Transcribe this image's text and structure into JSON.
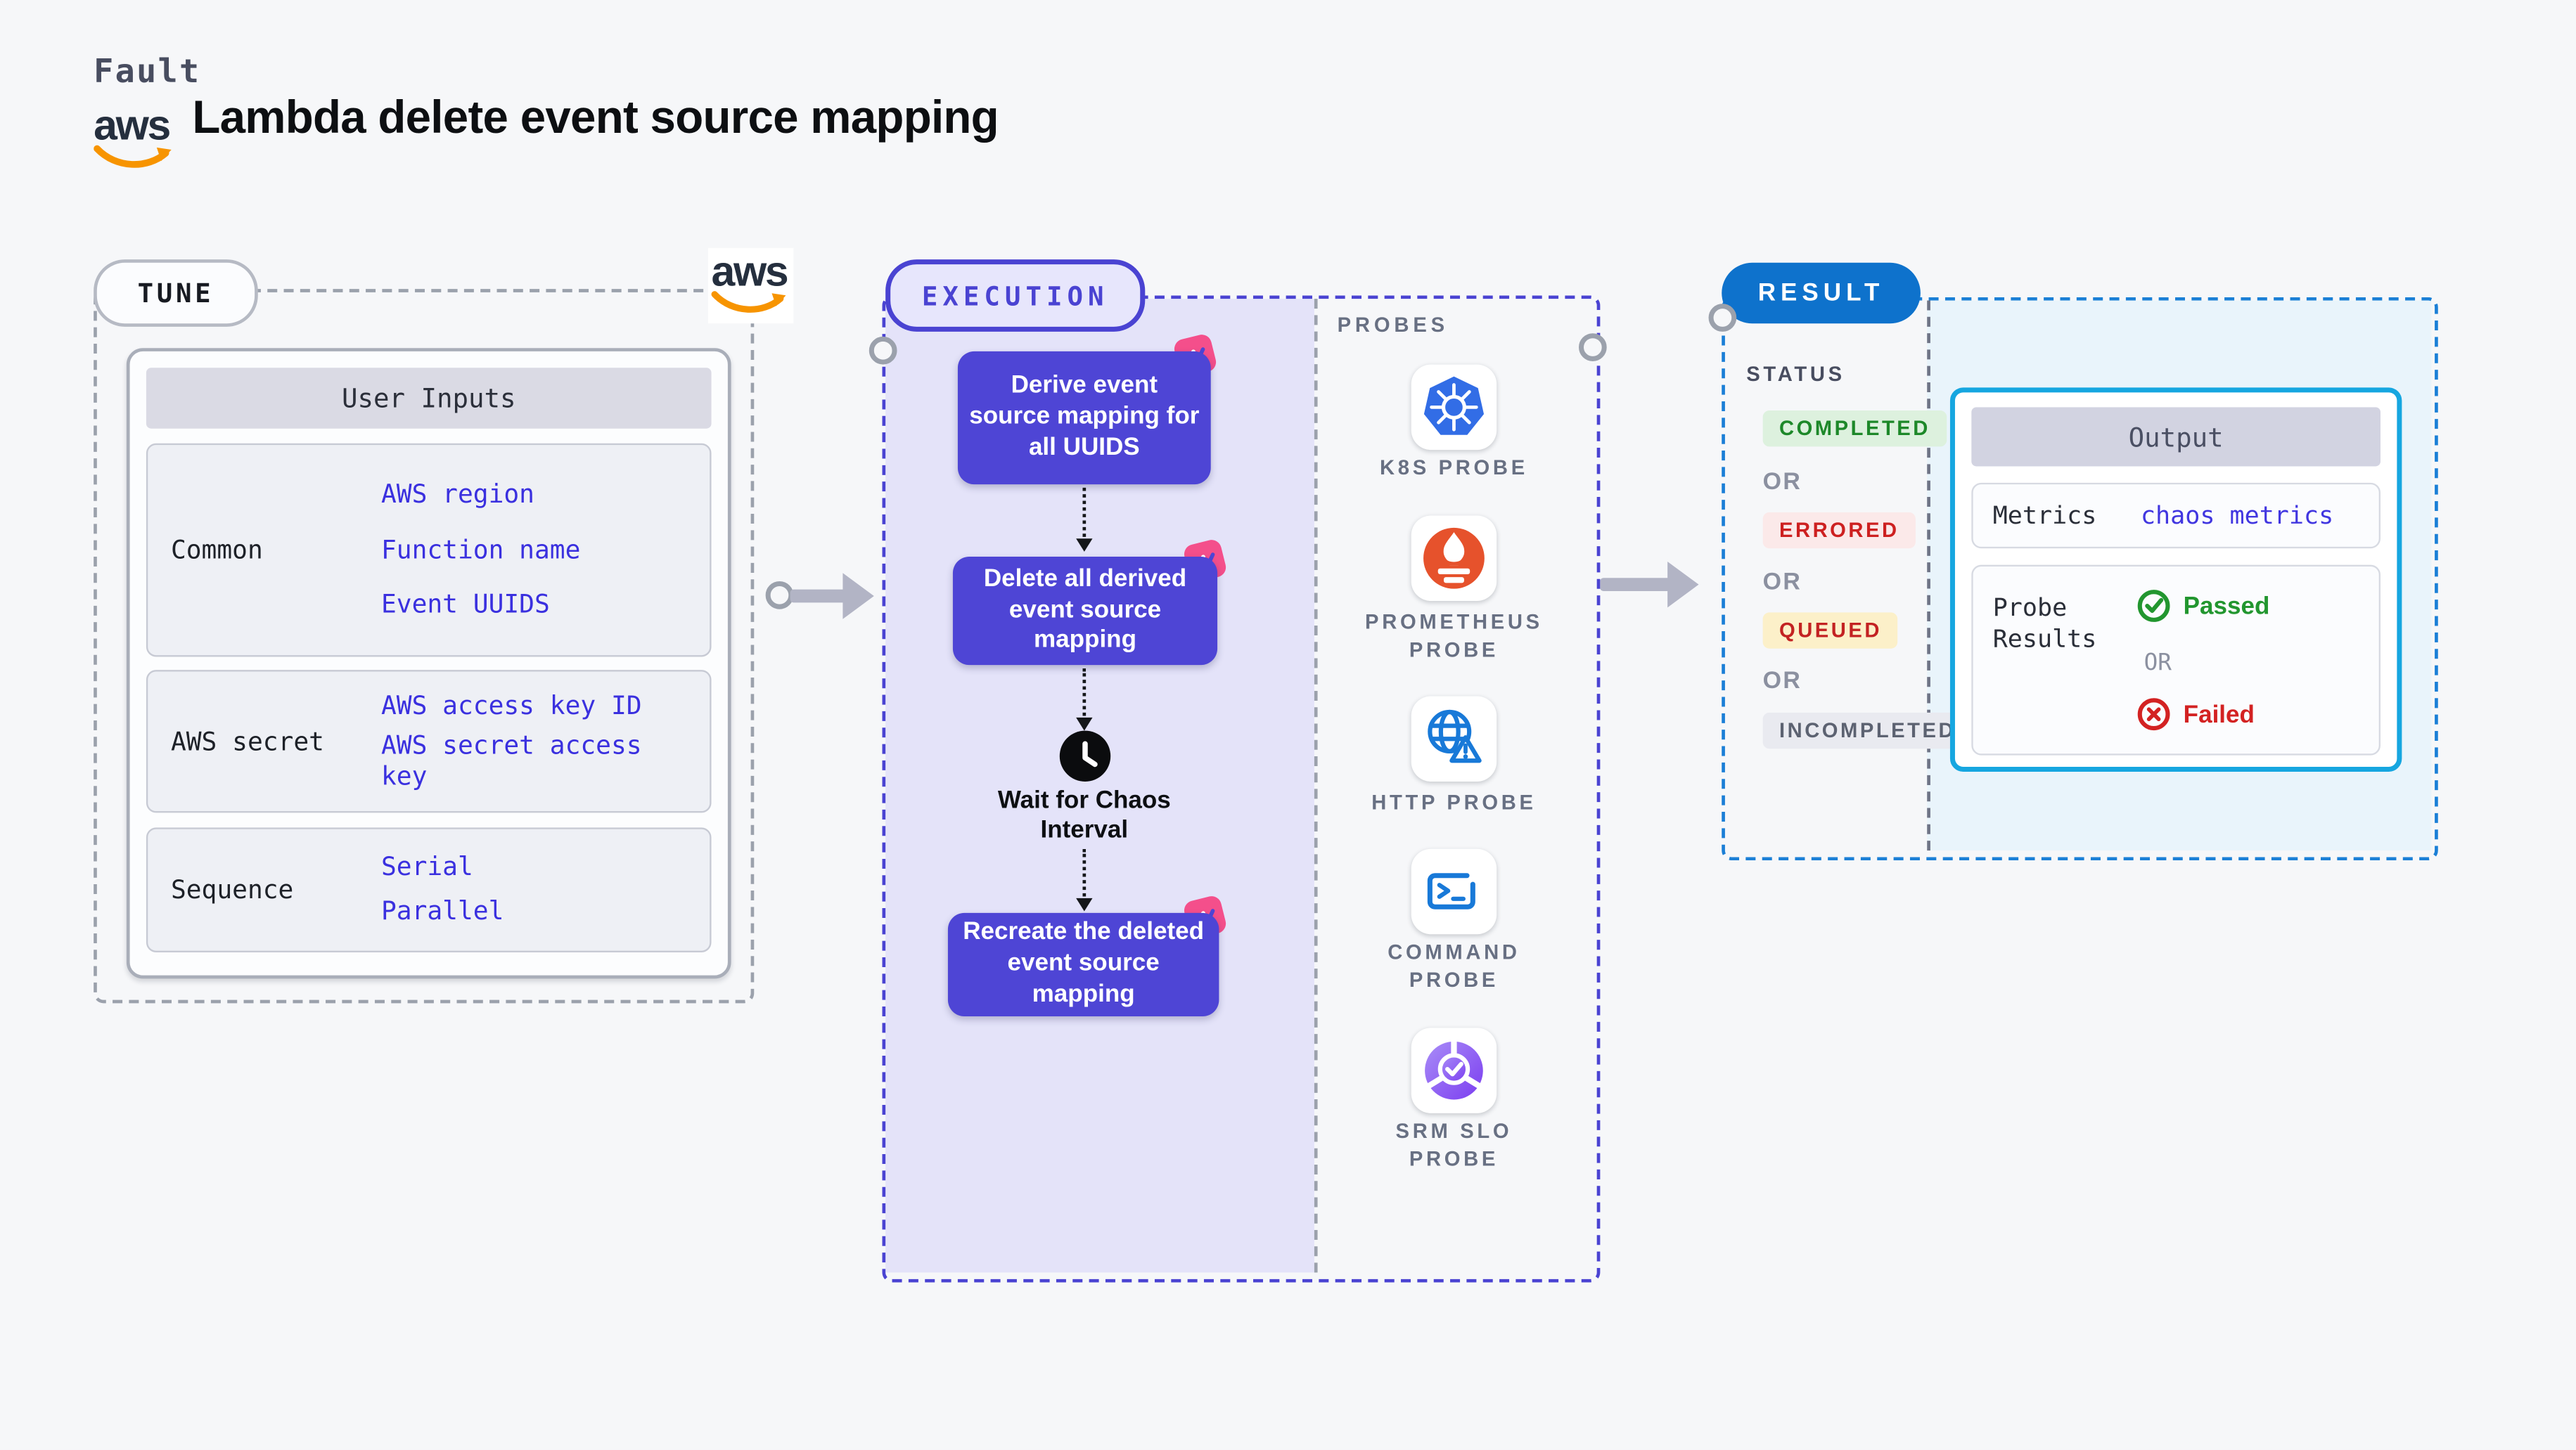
{
  "page": {
    "fault_label": "Fault",
    "title": "Lambda delete event source mapping",
    "background": "#f6f7f9"
  },
  "aws_logo": {
    "text": "aws",
    "text_color": "#252f3e",
    "smile_color": "#f79400"
  },
  "tune": {
    "pill_label": "TUNE",
    "table": {
      "header": "User Inputs",
      "rows": [
        {
          "label": "Common",
          "links": [
            "AWS region",
            "Function name",
            "Event UUIDS"
          ]
        },
        {
          "label": "AWS secret",
          "links": [
            "AWS access key ID",
            "AWS secret access key"
          ]
        },
        {
          "label": "Sequence",
          "links": [
            "Serial",
            "Parallel"
          ]
        }
      ]
    },
    "link_color": "#3a30df"
  },
  "execution": {
    "pill_label": "EXECUTION",
    "accent_color": "#4a43d2",
    "node_color": "#4e45d5",
    "badge_color": "#f44f8b",
    "nodes": [
      "Derive event source mapping for all UUIDS",
      "Delete all derived event source mapping",
      "Recreate the deleted event source mapping"
    ],
    "wait_label": "Wait for Chaos Interval"
  },
  "probes": {
    "label": "PROBES",
    "items": [
      {
        "name": "K8S PROBE",
        "icon": "kubernetes-icon",
        "color": "#326de6"
      },
      {
        "name": "PROMETHEUS PROBE",
        "icon": "prometheus-icon",
        "color": "#e6522c"
      },
      {
        "name": "HTTP PROBE",
        "icon": "http-globe-warning-icon",
        "color": "#1879d8"
      },
      {
        "name": "COMMAND PROBE",
        "icon": "terminal-icon",
        "color": "#1879d8"
      },
      {
        "name": "SRM SLO PROBE",
        "icon": "srm-slo-icon",
        "color": "#7b3df0"
      }
    ]
  },
  "result": {
    "pill_label": "RESULT",
    "pill_color": "#0e72cc",
    "status_label": "STATUS",
    "or_label": "OR",
    "statuses": [
      {
        "label": "COMPLETED",
        "fg": "#1d8829",
        "bg": "#ddf1de"
      },
      {
        "label": "ERRORED",
        "fg": "#cd2020",
        "bg": "#fbe9e9"
      },
      {
        "label": "QUEUED",
        "fg": "#c32222",
        "bg": "#fcf0c9"
      },
      {
        "label": "INCOMPLETED",
        "fg": "#5c6271",
        "bg": "#e9eaf0"
      }
    ],
    "output": {
      "header": "Output",
      "border_color": "#16a6e0",
      "metrics_label": "Metrics",
      "metrics_value": "chaos metrics",
      "probe_results_label": "Probe Results",
      "passed_label": "Passed",
      "passed_color": "#22962f",
      "failed_label": "Failed",
      "failed_color": "#d32222"
    }
  }
}
